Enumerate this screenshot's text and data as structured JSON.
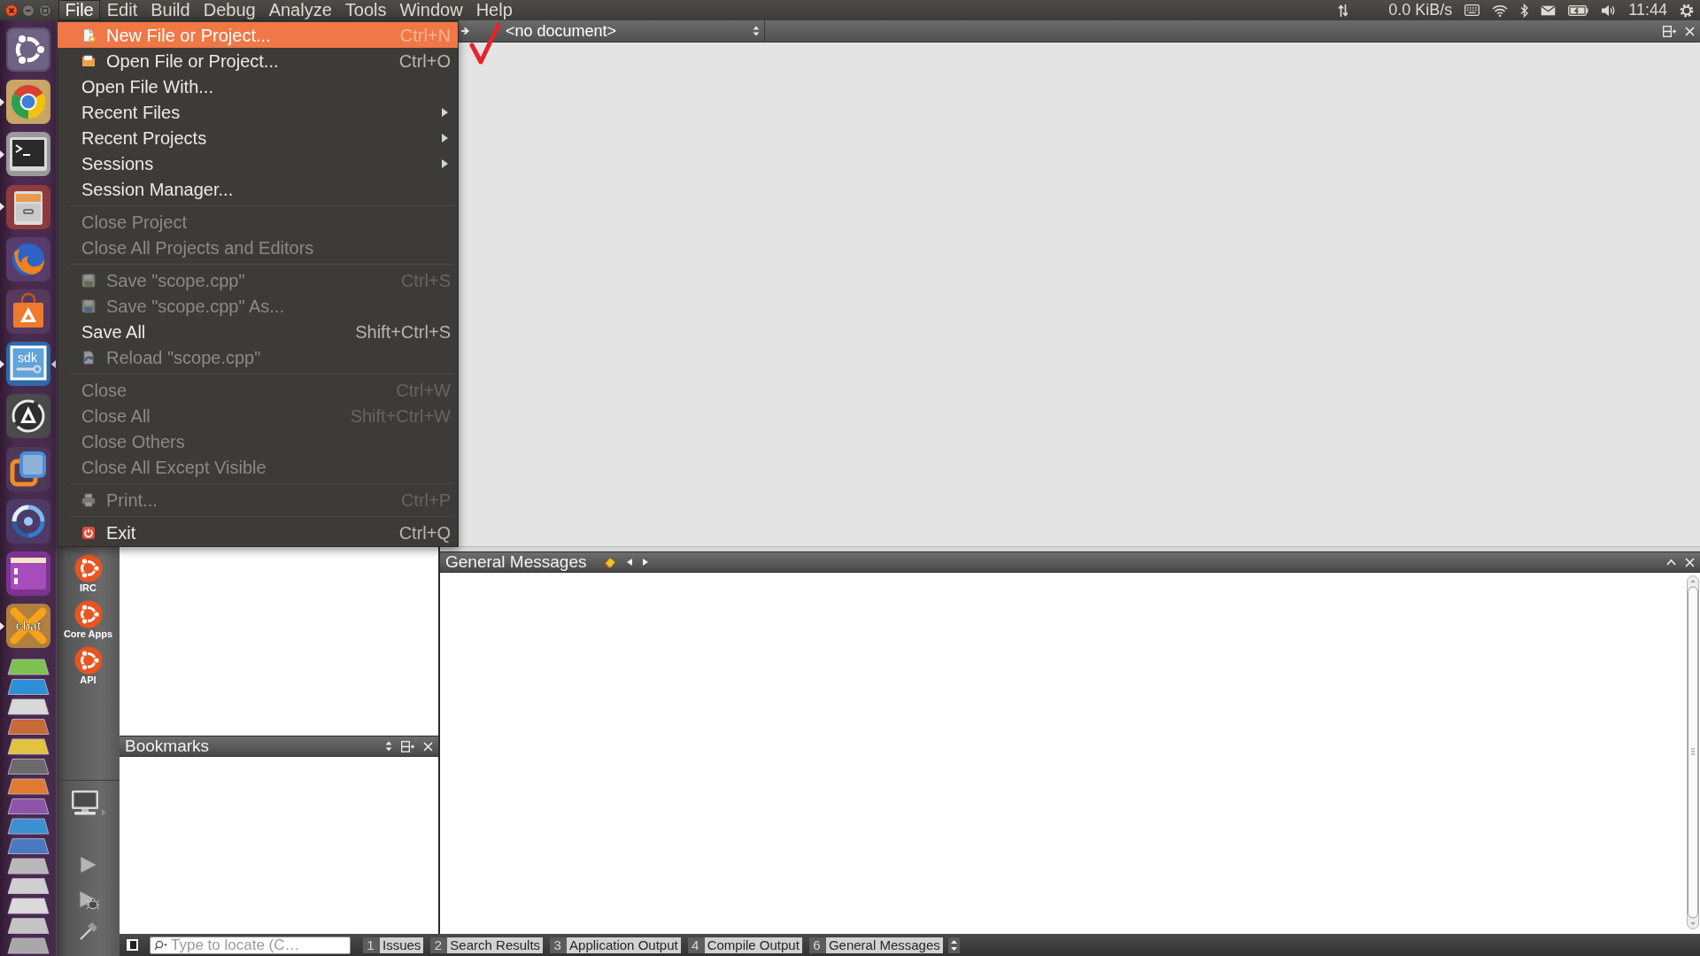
{
  "top_panel": {
    "menus": [
      {
        "label": "File",
        "selected": true
      },
      {
        "label": "Edit",
        "selected": false
      },
      {
        "label": "Build",
        "selected": false
      },
      {
        "label": "Debug",
        "selected": false
      },
      {
        "label": "Analyze",
        "selected": false
      },
      {
        "label": "Tools",
        "selected": false
      },
      {
        "label": "Window",
        "selected": false
      },
      {
        "label": "Help",
        "selected": false
      }
    ],
    "network_speed": "0.0 KiB/s",
    "clock": "11:44"
  },
  "launcher": {
    "items": [
      {
        "running": false,
        "focused": false
      },
      {
        "running": true,
        "focused": false
      },
      {
        "running": true,
        "focused": false
      },
      {
        "running": true,
        "focused": false
      },
      {
        "running": false,
        "focused": false
      },
      {
        "running": false,
        "focused": false
      },
      {
        "running": true,
        "focused": true,
        "icon_text": "sdk"
      },
      {
        "running": false,
        "focused": false
      },
      {
        "running": false,
        "focused": false
      },
      {
        "running": false,
        "focused": false
      },
      {
        "running": false,
        "focused": false
      },
      {
        "running": true,
        "focused": false,
        "icon_text": "chat"
      }
    ]
  },
  "mode_bar": {
    "items": [
      {
        "label": "IRC"
      },
      {
        "label": "Core Apps"
      },
      {
        "label": "API"
      }
    ]
  },
  "file_menu": {
    "items": [
      {
        "kind": "item",
        "label": "New File or Project...",
        "shortcut": "Ctrl+N",
        "selected": true,
        "disabled": false
      },
      {
        "kind": "item",
        "label": "Open File or Project...",
        "shortcut": "Ctrl+O",
        "selected": false,
        "disabled": false
      },
      {
        "kind": "item",
        "label": "Open File With...",
        "selected": false,
        "disabled": false
      },
      {
        "kind": "submenu",
        "label": "Recent Files",
        "selected": false,
        "disabled": false
      },
      {
        "kind": "submenu",
        "label": "Recent Projects",
        "selected": false,
        "disabled": false
      },
      {
        "kind": "submenu",
        "label": "Sessions",
        "selected": false,
        "disabled": false
      },
      {
        "kind": "item",
        "label": "Session Manager...",
        "selected": false,
        "disabled": false
      },
      {
        "kind": "separator"
      },
      {
        "kind": "item",
        "label": "Close Project",
        "selected": false,
        "disabled": true
      },
      {
        "kind": "item",
        "label": "Close All Projects and Editors",
        "selected": false,
        "disabled": true
      },
      {
        "kind": "separator"
      },
      {
        "kind": "item",
        "label": "Save \"scope.cpp\"",
        "shortcut": "Ctrl+S",
        "selected": false,
        "disabled": true
      },
      {
        "kind": "item",
        "label": "Save \"scope.cpp\" As...",
        "selected": false,
        "disabled": true
      },
      {
        "kind": "item",
        "label": "Save All",
        "shortcut": "Shift+Ctrl+S",
        "selected": false,
        "disabled": false
      },
      {
        "kind": "item",
        "label": "Reload \"scope.cpp\"",
        "selected": false,
        "disabled": true
      },
      {
        "kind": "separator"
      },
      {
        "kind": "item",
        "label": "Close",
        "shortcut": "Ctrl+W",
        "selected": false,
        "disabled": true
      },
      {
        "kind": "item",
        "label": "Close All",
        "shortcut": "Shift+Ctrl+W",
        "selected": false,
        "disabled": true
      },
      {
        "kind": "item",
        "label": "Close Others",
        "selected": false,
        "disabled": true
      },
      {
        "kind": "item",
        "label": "Close All Except Visible",
        "selected": false,
        "disabled": true
      },
      {
        "kind": "separator"
      },
      {
        "kind": "item",
        "label": "Print...",
        "shortcut": "Ctrl+P",
        "selected": false,
        "disabled": true
      },
      {
        "kind": "separator"
      },
      {
        "kind": "item",
        "label": "Exit",
        "shortcut": "Ctrl+Q",
        "selected": false,
        "disabled": false
      }
    ]
  },
  "editor": {
    "document": "<no document>"
  },
  "bookmarks": {
    "title": "Bookmarks"
  },
  "output_pane": {
    "title": "General Messages"
  },
  "status_bar": {
    "locator": {
      "placeholder": "Type to locate (C…"
    },
    "output_buttons": [
      {
        "number": "1",
        "label": "Issues"
      },
      {
        "number": "2",
        "label": "Search Results"
      },
      {
        "number": "3",
        "label": "Application Output"
      },
      {
        "number": "4",
        "label": "Compile Output"
      },
      {
        "number": "6",
        "label": "General Messages"
      }
    ]
  }
}
